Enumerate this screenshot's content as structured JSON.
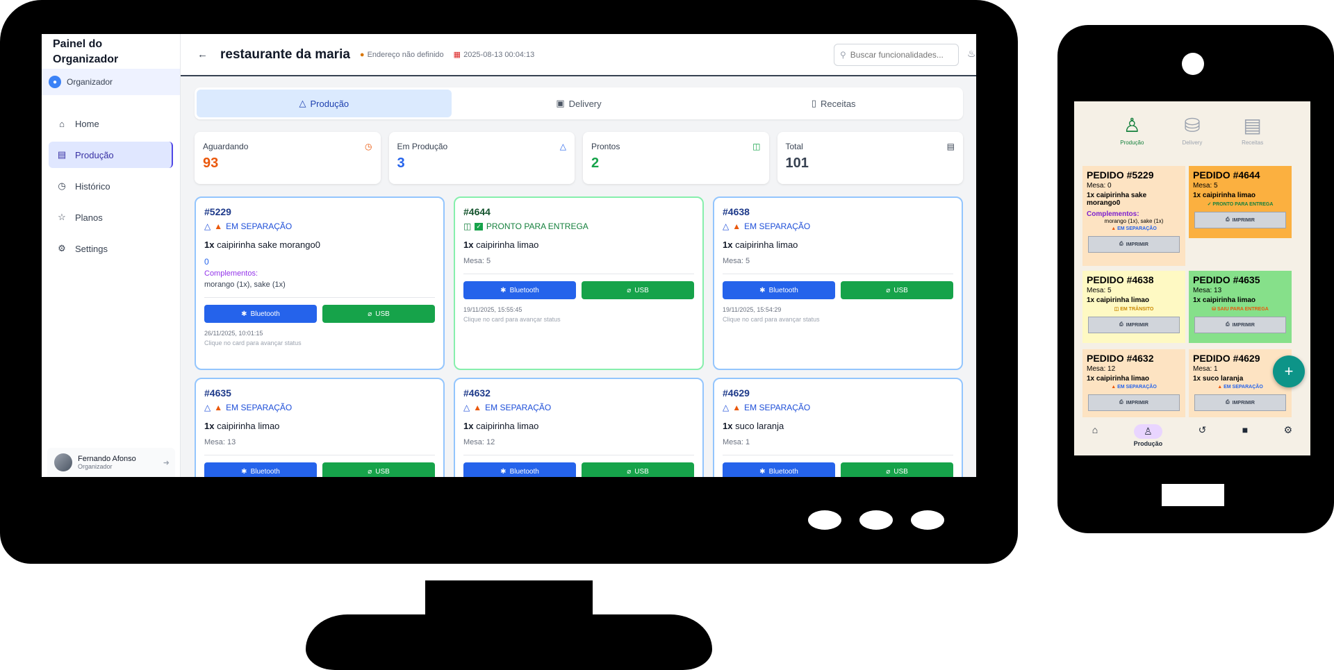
{
  "sidebar": {
    "title": "Painel do Organizador",
    "role": "Organizador",
    "items": [
      {
        "label": "Home",
        "icon": "home-icon"
      },
      {
        "label": "Produção",
        "icon": "bar-chart-icon"
      },
      {
        "label": "Histórico",
        "icon": "clock-icon"
      },
      {
        "label": "Planos",
        "icon": "star-icon"
      },
      {
        "label": "Settings",
        "icon": "gear-icon"
      }
    ],
    "user": {
      "name": "Fernando Afonso",
      "role": "Organizador"
    }
  },
  "header": {
    "restaurant": "restaurante da maria",
    "address": "Endereço não definido",
    "datetime": "2025-08-13 00:04:13",
    "search_placeholder": "Buscar funcionalidades..."
  },
  "tabs": [
    {
      "label": "Produção",
      "active": true
    },
    {
      "label": "Delivery",
      "active": false
    },
    {
      "label": "Receitas",
      "active": false
    }
  ],
  "stats": [
    {
      "label": "Aguardando",
      "value": "93",
      "color": "#ea580c"
    },
    {
      "label": "Em Produção",
      "value": "3",
      "color": "#2563eb"
    },
    {
      "label": "Prontos",
      "value": "2",
      "color": "#16a34a"
    },
    {
      "label": "Total",
      "value": "101",
      "color": "#374151"
    }
  ],
  "orders": [
    {
      "id": "#5229",
      "status": "EM SEPARAÇÃO",
      "qty": "1x",
      "item": "caipirinha sake morango0",
      "zero": "0",
      "comp_label": "Complementos:",
      "comp_value": "morango (1x), sake (1x)",
      "bt": "Bluetooth",
      "usb": "USB",
      "ts": "26/11/2025, 10:01:15",
      "hint": "Clique no card para avançar status"
    },
    {
      "id": "#4644",
      "status": "PRONTO PARA ENTREGA",
      "qty": "1x",
      "item": "caipirinha limao",
      "mesa": "Mesa: 5",
      "bt": "Bluetooth",
      "usb": "USB",
      "ts": "19/11/2025, 15:55:45",
      "hint": "Clique no card para avançar status"
    },
    {
      "id": "#4638",
      "status": "EM SEPARAÇÃO",
      "qty": "1x",
      "item": "caipirinha limao",
      "mesa": "Mesa: 5",
      "bt": "Bluetooth",
      "usb": "USB",
      "ts": "19/11/2025, 15:54:29",
      "hint": "Clique no card para avançar status"
    },
    {
      "id": "#4635",
      "status": "EM SEPARAÇÃO",
      "qty": "1x",
      "item": "caipirinha limao",
      "mesa": "Mesa: 13",
      "bt": "Bluetooth",
      "usb": "USB"
    },
    {
      "id": "#4632",
      "status": "EM SEPARAÇÃO",
      "qty": "1x",
      "item": "caipirinha limao",
      "mesa": "Mesa: 12",
      "bt": "Bluetooth",
      "usb": "USB"
    },
    {
      "id": "#4629",
      "status": "EM SEPARAÇÃO",
      "qty": "1x",
      "item": "suco laranja",
      "mesa": "Mesa: 1",
      "bt": "Bluetooth",
      "usb": "USB"
    }
  ],
  "phone": {
    "top_tabs": [
      "Produção",
      "Delivery",
      "Receitas"
    ],
    "print_label": "IMPRIMIR",
    "bottom_active": "Produção",
    "orders": [
      {
        "id": "PEDIDO #5229",
        "mesa": "Mesa: 0",
        "item": "1x caipirinha sake morango0",
        "comp_label": "Complementos:",
        "comp_value": "morango (1x), sake (1x)",
        "status": "EM SEPARAÇÃO",
        "bg": "#fde3c2"
      },
      {
        "id": "PEDIDO #4644",
        "mesa": "Mesa: 5",
        "item": "1x caipirinha limao",
        "status": "PRONTO PARA ENTREGA",
        "bg": "#fbb040"
      },
      {
        "id": "PEDIDO #4638",
        "mesa": "Mesa: 5",
        "item": "1x caipirinha limao",
        "status": "EM TRÂNSITO",
        "bg": "#fef9c3"
      },
      {
        "id": "PEDIDO #4635",
        "mesa": "Mesa: 13",
        "item": "1x caipirinha limao",
        "status": "SAIU PARA ENTREGA",
        "bg": "#86e08a"
      },
      {
        "id": "PEDIDO #4632",
        "mesa": "Mesa: 12",
        "item": "1x caipirinha limao",
        "status": "EM SEPARAÇÃO",
        "bg": "#fde3c2"
      },
      {
        "id": "PEDIDO #4629",
        "mesa": "Mesa: 1",
        "item": "1x suco laranja",
        "status": "EM SEPARAÇÃO",
        "bg": "#fde3c2"
      }
    ]
  }
}
